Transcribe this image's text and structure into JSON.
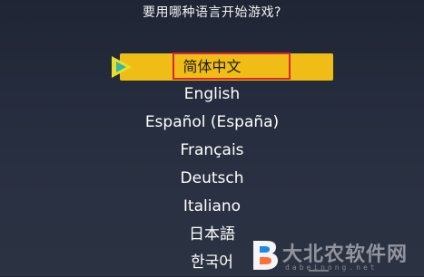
{
  "prompt": "要用哪种语言开始游戏?",
  "languages": [
    {
      "label": "简体中文",
      "selected": true
    },
    {
      "label": "English"
    },
    {
      "label": "Español (España)"
    },
    {
      "label": "Français"
    },
    {
      "label": "Deutsch"
    },
    {
      "label": "Italiano"
    },
    {
      "label": "日本語"
    },
    {
      "label": "한국어"
    }
  ],
  "colors": {
    "selection_bar": "#f0bd16",
    "focus_outline": "#d9262b",
    "background": "#252c3d",
    "selector_icon_outer": "#e6e02a",
    "selector_icon_inner": "#37b6a9"
  },
  "icons": {
    "selector": "play-arrow-icon",
    "watermark_logo": "b-logo-icon"
  },
  "watermark": {
    "text": "大北农软件网",
    "url": "dabeinong.net"
  }
}
